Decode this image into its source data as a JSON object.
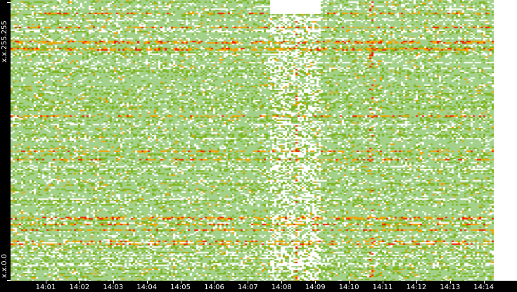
{
  "chart_data": {
    "type": "heatmap",
    "title": "",
    "ylabels": [
      "x.x.255.255",
      "x.x.0.0"
    ],
    "xlabels": [
      "14:01",
      "14:02",
      "14:03",
      "14:04",
      "14:05",
      "14:06",
      "14:07",
      "14:08",
      "14:09",
      "14:10",
      "14:11",
      "14:12",
      "14:13",
      "14:14"
    ],
    "xlabel": "",
    "ylabel": "",
    "colors": {
      "none": "#ffffff",
      "low": "#a3d18a",
      "mid": "#7fb51f",
      "high": "#f5a300",
      "max": "#ee2200",
      "axis_bg": "#000000"
    }
  }
}
